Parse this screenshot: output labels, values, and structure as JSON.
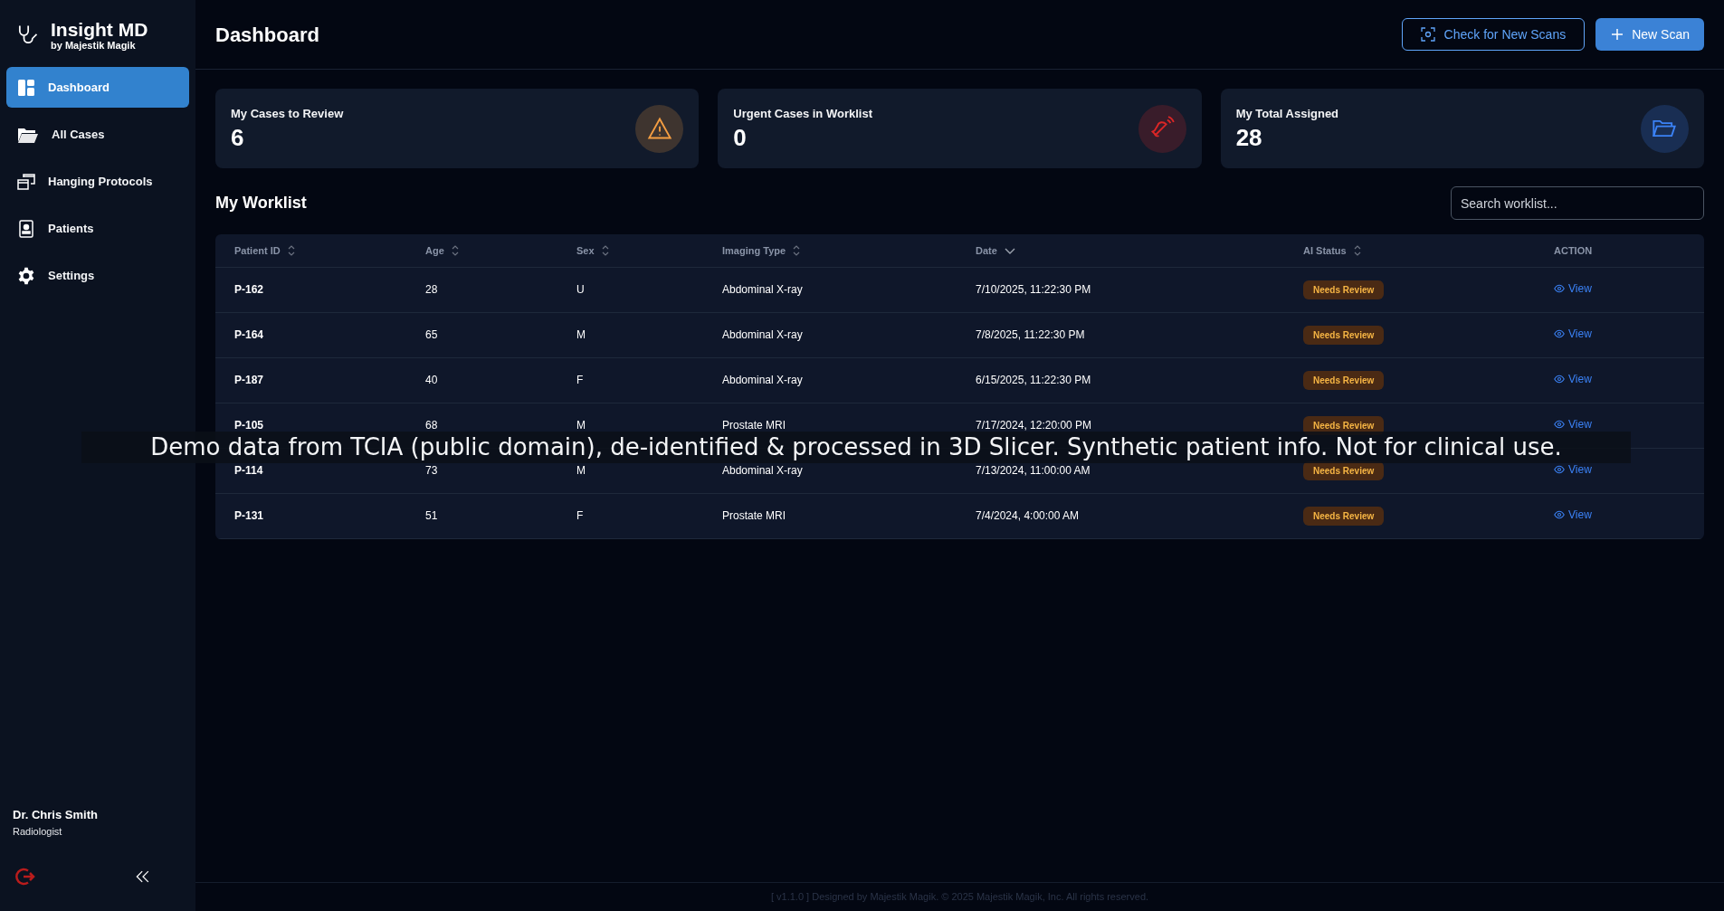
{
  "brand": {
    "title": "Insight MD",
    "subtitle": "by Majestik Magik"
  },
  "sidebar": {
    "items": [
      {
        "label": "Dashboard",
        "kind": "dashboard",
        "selected": true
      },
      {
        "label": "All Cases",
        "kind": "folder",
        "selected": false
      },
      {
        "label": "Hanging Protocols",
        "kind": "windows",
        "selected": false
      },
      {
        "label": "Patients",
        "kind": "badge",
        "selected": false
      },
      {
        "label": "Settings",
        "kind": "gear",
        "selected": false
      }
    ],
    "user": {
      "name": "Dr. Chris Smith",
      "role": "Radiologist"
    }
  },
  "header": {
    "title": "Dashboard",
    "buttons": [
      {
        "label": "Check for New Scans",
        "kind": "outline"
      },
      {
        "label": "New Scan",
        "kind": "primary"
      }
    ]
  },
  "stats": [
    {
      "label": "My Cases to Review",
      "value": "6",
      "kind": "warning",
      "color": "#f59e42"
    },
    {
      "label": "Urgent Cases in Worklist",
      "value": "0",
      "kind": "bell",
      "color": "#dc2626"
    },
    {
      "label": "My Total Assigned",
      "value": "28",
      "kind": "folder",
      "color": "#3b82f6"
    }
  ],
  "worklist": {
    "title": "My Worklist",
    "search": {
      "placeholder": "Search worklist..."
    },
    "columns": [
      {
        "label": "Patient ID",
        "sorted": false
      },
      {
        "label": "Age",
        "sorted": false
      },
      {
        "label": "Sex",
        "sorted": false
      },
      {
        "label": "Imaging Type",
        "sorted": false
      },
      {
        "label": "Date",
        "sorted": true
      },
      {
        "label": "AI Status",
        "sorted": false
      },
      {
        "label": "ACTION"
      }
    ],
    "rows": [
      {
        "id": "P-162",
        "age": "28",
        "sex": "U",
        "type": "Abdominal X-ray",
        "date": "7/10/2025, 11:22:30 PM",
        "status": "Needs Review",
        "action": "View"
      },
      {
        "id": "P-164",
        "age": "65",
        "sex": "M",
        "type": "Abdominal X-ray",
        "date": "7/8/2025, 11:22:30 PM",
        "status": "Needs Review",
        "action": "View"
      },
      {
        "id": "P-187",
        "age": "40",
        "sex": "F",
        "type": "Abdominal X-ray",
        "date": "6/15/2025, 11:22:30 PM",
        "status": "Needs Review",
        "action": "View"
      },
      {
        "id": "P-105",
        "age": "68",
        "sex": "M",
        "type": "Prostate MRI",
        "date": "7/17/2024, 12:20:00 PM",
        "status": "Needs Review",
        "action": "View"
      },
      {
        "id": "P-114",
        "age": "73",
        "sex": "M",
        "type": "Abdominal X-ray",
        "date": "7/13/2024, 11:00:00 AM",
        "status": "Needs Review",
        "action": "View"
      },
      {
        "id": "P-131",
        "age": "51",
        "sex": "F",
        "type": "Prostate MRI",
        "date": "7/4/2024, 4:00:00 AM",
        "status": "Needs Review",
        "action": "View"
      }
    ]
  },
  "caption": "Demo data from TCIA (public domain), de-identified & processed in 3D Slicer. Synthetic patient info. Not for clinical use.",
  "footer": "[ v1.1.0 ] Designed by Majestik Magik. © 2025 Majestik Magik, Inc. All rights reserved."
}
